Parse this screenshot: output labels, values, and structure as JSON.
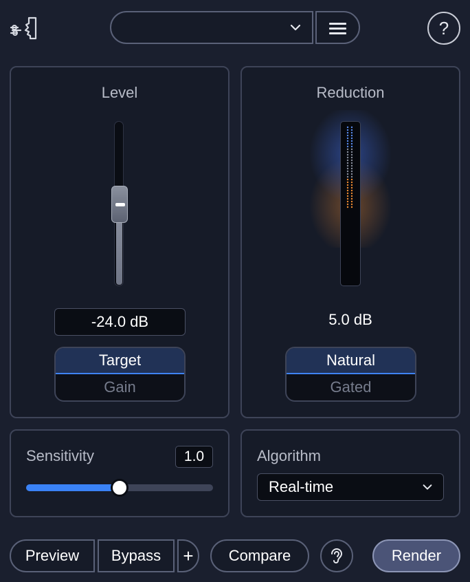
{
  "header": {
    "logo_icon": "voice-profile-icon",
    "preset_value": "",
    "menu_icon": "hamburger-menu-icon",
    "help_label": "?"
  },
  "level": {
    "title": "Level",
    "value": "-24.0 dB",
    "slider_level": 0.5,
    "modes": [
      "Target",
      "Gain"
    ],
    "selected_mode": "Target"
  },
  "reduction": {
    "title": "Reduction",
    "value": "5.0 dB",
    "modes": [
      "Natural",
      "Gated"
    ],
    "selected_mode": "Natural"
  },
  "sensitivity": {
    "label": "Sensitivity",
    "value": "1.0",
    "level": 0.5
  },
  "algorithm": {
    "label": "Algorithm",
    "selected": "Real-time"
  },
  "footer": {
    "preview": "Preview",
    "bypass": "Bypass",
    "plus": "+",
    "compare": "Compare",
    "ear_icon": "ear-icon",
    "render": "Render"
  },
  "colors": {
    "accent": "#3a82f6",
    "meter_blue": "#5a8cf0",
    "meter_grey": "#8a909e",
    "meter_orange": "#f08c32"
  }
}
